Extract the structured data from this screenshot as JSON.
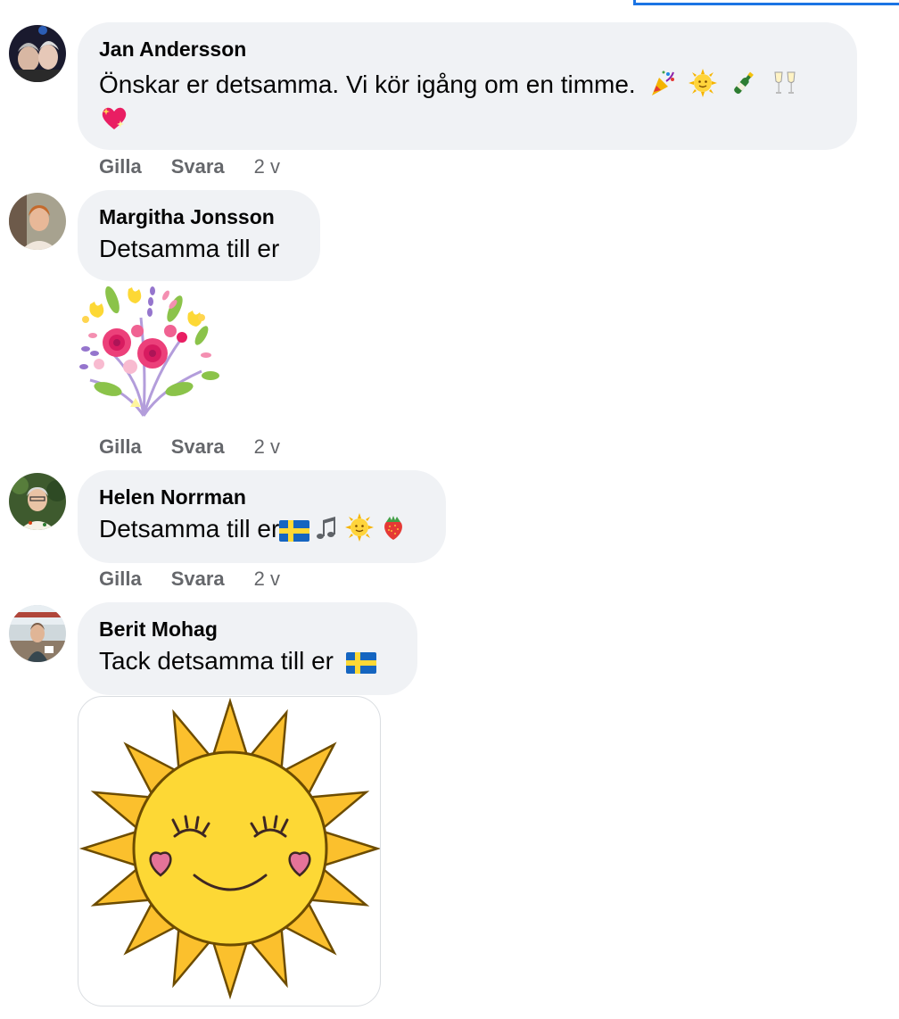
{
  "comments": [
    {
      "author": "Jan Andersson",
      "text": "Önskar er detsamma. Vi kör igång om en timme.",
      "emojis": [
        "party-popper",
        "sun-with-face",
        "champagne",
        "clinking-glasses",
        "sparkling-heart"
      ],
      "actions": {
        "like": "Gilla",
        "reply": "Svara",
        "time": "2 v"
      }
    },
    {
      "author": "Margitha Jonsson",
      "text": "Detsamma till er",
      "sticker": "flower-bouquet",
      "actions": {
        "like": "Gilla",
        "reply": "Svara",
        "time": "2 v"
      }
    },
    {
      "author": "Helen Norrman",
      "text": "Detsamma till er",
      "emojis": [
        "sweden-flag",
        "musical-notes",
        "sun-with-face",
        "strawberry"
      ],
      "actions": {
        "like": "Gilla",
        "reply": "Svara",
        "time": "2 v"
      }
    },
    {
      "author": "Berit Mohag",
      "text": "Tack detsamma till er",
      "emojis": [
        "sweden-flag"
      ],
      "sticker": "smiling-sunflower"
    }
  ],
  "colors": {
    "bubble": "#f0f2f5",
    "secondary_text": "#65676b",
    "primary_text": "#050505",
    "accent": "#1b74e4"
  }
}
